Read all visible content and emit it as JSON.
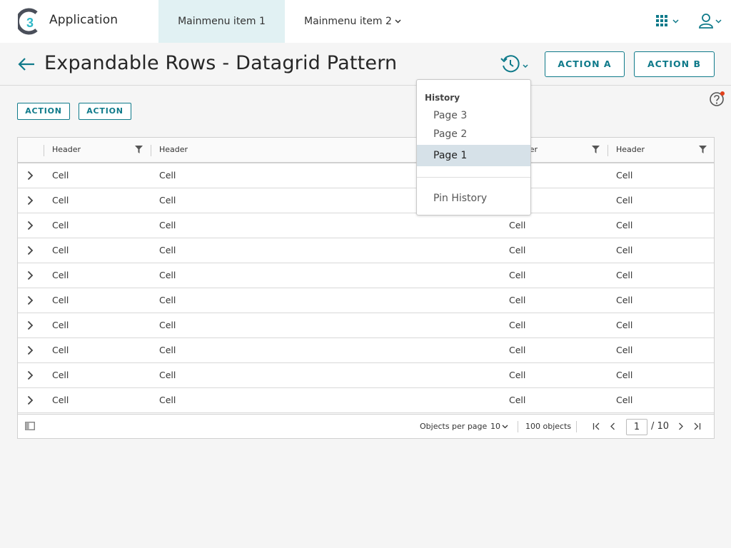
{
  "app": {
    "title": "Application"
  },
  "nav": {
    "menu": [
      {
        "label": "Mainmenu item 1",
        "active": true
      },
      {
        "label": "Mainmenu item 2",
        "active": false
      }
    ]
  },
  "header": {
    "title": "Expandable Rows - Datagrid Pattern",
    "action_a": "ACTION A",
    "action_b": "ACTION B"
  },
  "toolbar": {
    "action_1": "ACTION",
    "action_2": "ACTION"
  },
  "grid": {
    "headers": [
      "Header",
      "Header",
      "Header",
      "Header"
    ],
    "rows": [
      [
        "Cell",
        "Cell",
        "Cell",
        "Cell"
      ],
      [
        "Cell",
        "Cell",
        "Cell",
        "Cell"
      ],
      [
        "Cell",
        "Cell",
        "Cell",
        "Cell"
      ],
      [
        "Cell",
        "Cell",
        "Cell",
        "Cell"
      ],
      [
        "Cell",
        "Cell",
        "Cell",
        "Cell"
      ],
      [
        "Cell",
        "Cell",
        "Cell",
        "Cell"
      ],
      [
        "Cell",
        "Cell",
        "Cell",
        "Cell"
      ],
      [
        "Cell",
        "Cell",
        "Cell",
        "Cell"
      ],
      [
        "Cell",
        "Cell",
        "Cell",
        "Cell"
      ],
      [
        "Cell",
        "Cell",
        "Cell",
        "Cell"
      ]
    ],
    "footer": {
      "per_page_label": "Objects per page",
      "per_page_value": "10",
      "total": "100 objects",
      "current_page": "1",
      "page_count": "/ 10"
    }
  },
  "history_dropdown": {
    "title": "History",
    "items": [
      "Page 3",
      "Page 2",
      "Page 1"
    ],
    "selected": "Page 1",
    "pin_label": "Pin History"
  },
  "colors": {
    "accent": "#0f7a8a",
    "active_menu_bg": "#e1f1f3",
    "selected_item_bg": "#d6e1e8",
    "notification_dot": "#e2401c"
  },
  "icons": [
    "c3-logo",
    "chevron-down-icon",
    "apps-grid-icon",
    "user-icon",
    "back-arrow-icon",
    "history-icon",
    "help-icon",
    "filter-icon",
    "chevron-right-icon",
    "column-toggle-icon",
    "first-page-icon",
    "prev-page-icon",
    "next-page-icon",
    "last-page-icon"
  ]
}
